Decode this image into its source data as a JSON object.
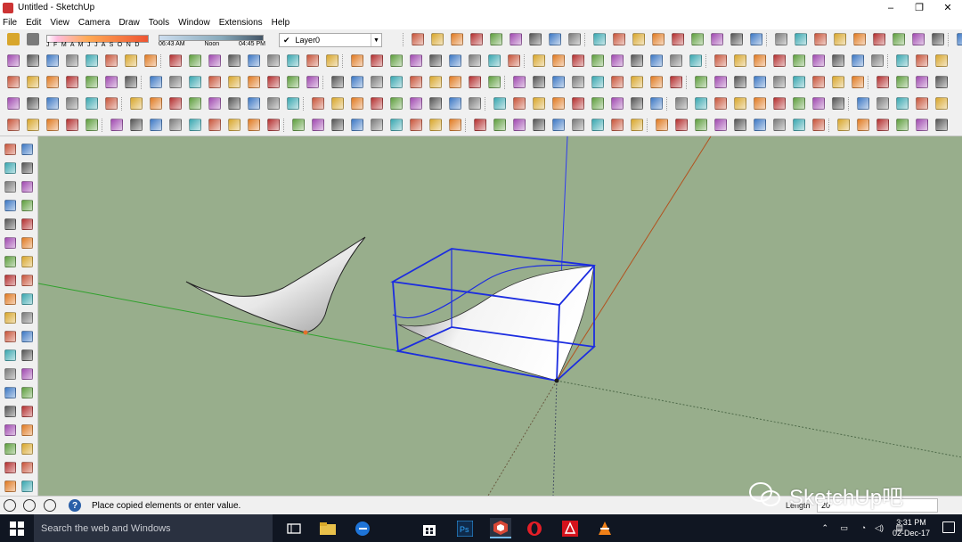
{
  "window": {
    "title": "Untitled - SketchUp",
    "min_icon": "–",
    "max_icon": "❐",
    "close_icon": "✕"
  },
  "menu": [
    "File",
    "Edit",
    "View",
    "Camera",
    "Draw",
    "Tools",
    "Window",
    "Extensions",
    "Help"
  ],
  "shadows": {
    "months": "J F M A M J J A S O N D",
    "time_start": "06:43 AM",
    "time_mid": "Noon",
    "time_end": "04:45 PM"
  },
  "layer": {
    "current": "Layer0",
    "check": "✔",
    "dropdown": "▼"
  },
  "status": {
    "message": "Place copied elements or enter value.",
    "help_icon": "?",
    "vcb_label": "Length",
    "vcb_value": "20"
  },
  "watermark": {
    "text": "SketchUp吧"
  },
  "taskbar": {
    "search_placeholder": "Search the web and Windows",
    "clock_time": "3:31 PM",
    "clock_date": "02-Dec-17",
    "apps": [
      "task-view",
      "file-explorer",
      "edge",
      "store",
      "photoshop",
      "sketchup",
      "opera",
      "acrobat",
      "vlc"
    ]
  },
  "colors": {
    "viewport_bg": "#98ae8c",
    "axis_blue": "#2f3cf0",
    "axis_red": "#b2521e",
    "axis_green": "#2fa12c",
    "selection_blue": "#1c2de0",
    "toolbar_bg": "#f0f0f0",
    "taskbar_bg": "#101622"
  }
}
